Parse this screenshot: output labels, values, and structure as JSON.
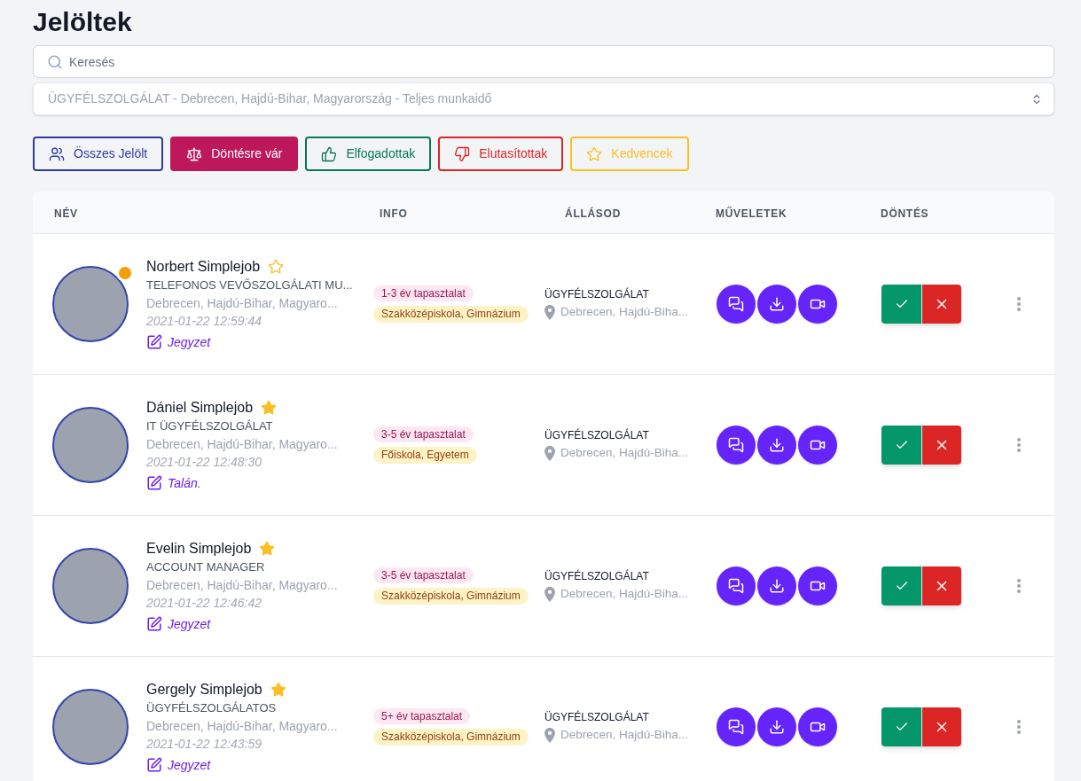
{
  "page": {
    "title": "Jelöltek"
  },
  "search": {
    "placeholder": "Keresés"
  },
  "job_select": {
    "value": "ÜGYFÉLSZOLGÁLAT - Debrecen, Hajdú-Bihar, Magyarország - Teljes munkaidő"
  },
  "filters": [
    {
      "kind": "all",
      "label": "Összes Jelölt",
      "color": "#2e3a9e",
      "selected": false
    },
    {
      "kind": "pending",
      "label": "Döntésre vár",
      "color": "#be185d",
      "selected": true
    },
    {
      "kind": "accepted",
      "label": "Elfogadottak",
      "color": "#047857",
      "selected": false
    },
    {
      "kind": "rejected",
      "label": "Elutasítottak",
      "color": "#dc2626",
      "selected": false
    },
    {
      "kind": "favorites",
      "label": "Kedvencek",
      "color": "#fbbf24",
      "selected": false
    }
  ],
  "table": {
    "columns": [
      "NÉV",
      "INFO",
      "ÁLLÁSOD",
      "MŰVELETEK",
      "DÖNTÉS"
    ],
    "rows": [
      {
        "name": "Norbert Simplejob",
        "favorite": false,
        "online": true,
        "position": "TELEFONOS VEVŐSZOLGÁLATI MU...",
        "location": "Debrecen, Hajdú-Bihar, Magyaro...",
        "date": "2021-01-22 12:59:44",
        "note": "Jegyzet",
        "experience": "1-3 év tapasztalat",
        "education": "Szakközépiskola, Gimnázium",
        "job_title": "ÜGYFÉLSZOLGÁLAT",
        "job_location": "Debrecen, Hajdú-Biha..."
      },
      {
        "name": "Dániel Simplejob",
        "favorite": true,
        "online": false,
        "position": "IT ÜGYFÉLSZOLGÁLAT",
        "location": "Debrecen, Hajdú-Bihar, Magyaro...",
        "date": "2021-01-22 12:48:30",
        "note": "Talán.",
        "experience": "3-5 év tapasztalat",
        "education": "Főiskola, Egyetem",
        "job_title": "ÜGYFÉLSZOLGÁLAT",
        "job_location": "Debrecen, Hajdú-Biha..."
      },
      {
        "name": "Evelin Simplejob",
        "favorite": true,
        "online": false,
        "position": "ACCOUNT MANAGER",
        "location": "Debrecen, Hajdú-Bihar, Magyaro...",
        "date": "2021-01-22 12:46:42",
        "note": "Jegyzet",
        "experience": "3-5 év tapasztalat",
        "education": "Szakközépiskola, Gimnázium",
        "job_title": "ÜGYFÉLSZOLGÁLAT",
        "job_location": "Debrecen, Hajdú-Biha..."
      },
      {
        "name": "Gergely Simplejob",
        "favorite": true,
        "online": false,
        "position": "ÜGYFÉLSZOLGÁLATOS",
        "location": "Debrecen, Hajdú-Bihar, Magyaro...",
        "date": "2021-01-22 12:43:59",
        "note": "Jegyzet",
        "experience": "5+ év tapasztalat",
        "education": "Szakközépiskola, Gimnázium",
        "job_title": "ÜGYFÉLSZOLGÁLAT",
        "job_location": "Debrecen, Hajdú-Biha..."
      }
    ]
  }
}
